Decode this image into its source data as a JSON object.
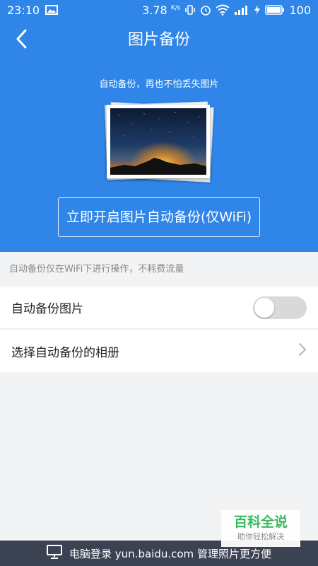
{
  "status_bar": {
    "time": "23:10",
    "net_speed": "3.78",
    "net_speed_unit": "K/s",
    "battery": "100",
    "icons": [
      "image-notification-icon",
      "vibrate-icon",
      "alarm-icon",
      "wifi-icon",
      "signal-icon",
      "charging-icon",
      "battery-icon"
    ]
  },
  "header": {
    "title": "图片备份",
    "back_icon": "chevron-left-icon"
  },
  "hero": {
    "tagline": "自动备份，再也不怕丢失图片",
    "start_button": "立即开启图片自动备份(仅WiFi)"
  },
  "notice": "自动备份仅在WiFi下进行操作，不耗费流量",
  "settings": {
    "auto_backup_label": "自动备份图片",
    "auto_backup_enabled": false,
    "select_album_label": "选择自动备份的相册"
  },
  "bottom_bar": {
    "text": "电脑登录 yun.baidu.com 管理照片更方便",
    "icon": "monitor-icon"
  },
  "watermark": {
    "main": "百科全说",
    "sub": "助你轻松解决"
  },
  "colors": {
    "brand_blue": "#2f86e8",
    "bottom_bar": "#3b4252",
    "watermark_green": "#2fb55a"
  }
}
